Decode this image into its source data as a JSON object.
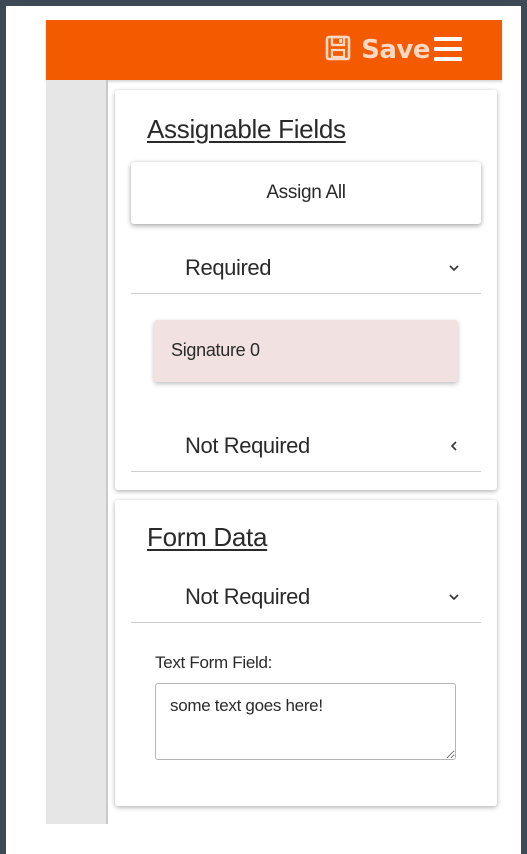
{
  "topbar": {
    "save_label": "Save",
    "save_icon": "floppy-disk-icon",
    "menu_icon": "hamburger-menu-icon",
    "background_color": "#f45b00"
  },
  "assignable_panel": {
    "title": "Assignable Fields",
    "assign_all_label": "Assign All",
    "required_section": {
      "label": "Required",
      "state": "expanded",
      "items": [
        {
          "label": "Signature 0",
          "color": "#f2e1e1"
        }
      ]
    },
    "not_required_section": {
      "label": "Not Required",
      "state": "collapsed"
    }
  },
  "form_data_panel": {
    "title": "Form Data",
    "not_required_section": {
      "label": "Not Required",
      "state": "expanded"
    },
    "text_field": {
      "label": "Text Form Field:",
      "value": "some text goes here!"
    }
  }
}
